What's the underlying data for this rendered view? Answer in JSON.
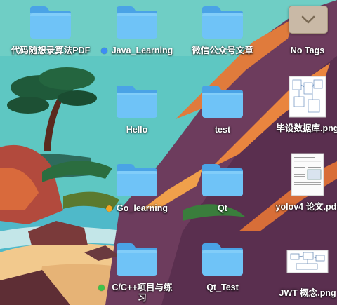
{
  "desktop": {
    "items": [
      {
        "id": "folder-code-pdf",
        "type": "folder",
        "label": "代码随想录算法PDF",
        "tag": null
      },
      {
        "id": "folder-java",
        "type": "folder",
        "label": "Java_Learning",
        "tag": "#3d8cf5"
      },
      {
        "id": "folder-wechat",
        "type": "folder",
        "label": "微信公众号文章",
        "tag": null
      },
      {
        "id": "item-no-tags",
        "type": "sort-control",
        "label": "No Tags",
        "tag": null
      },
      {
        "id": "folder-hello",
        "type": "folder",
        "label": "Hello",
        "tag": null
      },
      {
        "id": "folder-test",
        "type": "folder",
        "label": "test",
        "tag": null
      },
      {
        "id": "file-db-png",
        "type": "image-file",
        "label": "毕设数据库.png",
        "tag": null
      },
      {
        "id": "folder-go",
        "type": "folder",
        "label": "Go_learning",
        "tag": "#f5a524"
      },
      {
        "id": "folder-qt",
        "type": "folder",
        "label": "Qt",
        "tag": null
      },
      {
        "id": "file-yolo-pdf",
        "type": "pdf-file",
        "label": "yolov4 论文.pdf",
        "tag": null
      },
      {
        "id": "folder-cpp",
        "type": "folder",
        "label": "C/C++项目与练习",
        "tag": "#3fc24a"
      },
      {
        "id": "folder-qt-test",
        "type": "folder",
        "label": "Qt_Test",
        "tag": null
      },
      {
        "id": "file-jwt-png",
        "type": "image-file",
        "label": "JWT 概念.png",
        "tag": null
      }
    ]
  },
  "icons": {
    "folder": "folder-icon",
    "sort": "chevron-down-icon",
    "image": "image-file-icon",
    "pdf": "pdf-file-icon"
  },
  "colors": {
    "folder_front": "#6fc3f7",
    "folder_back": "#4aa3e6",
    "sky": "#5fc6c0",
    "rock": "#6a3f5c",
    "sand": "#f2c98d"
  }
}
